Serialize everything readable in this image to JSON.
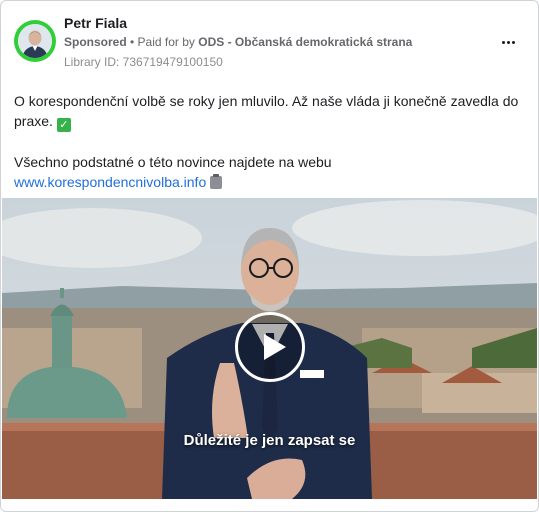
{
  "post": {
    "author": "Petr Fiala",
    "sponsored": "Sponsored",
    "paid_for_prefix": "• Paid for by",
    "payer": "ODS - Občanská demokratická strana",
    "library_id": "Library ID: 736719479100150",
    "body_line1": "O korespondenční volbě se roky jen mluvilo. Až naše vláda ji konečně zavedla do praxe.",
    "check_emoji": "✓",
    "body_line2": "Všechno podstatné o této novince najdete na webu",
    "link": "www.korespondencnivolba.info",
    "more_icon": "more-horizontal-icon",
    "avatar_icon": "profile-photo"
  },
  "video": {
    "caption": "Důležité je jen zapsat se",
    "play_icon": "play-icon"
  },
  "colors": {
    "avatar_ring": "#2fcf37",
    "link": "#216fdb",
    "check": "#35b24a",
    "text_secondary": "#65676b"
  }
}
